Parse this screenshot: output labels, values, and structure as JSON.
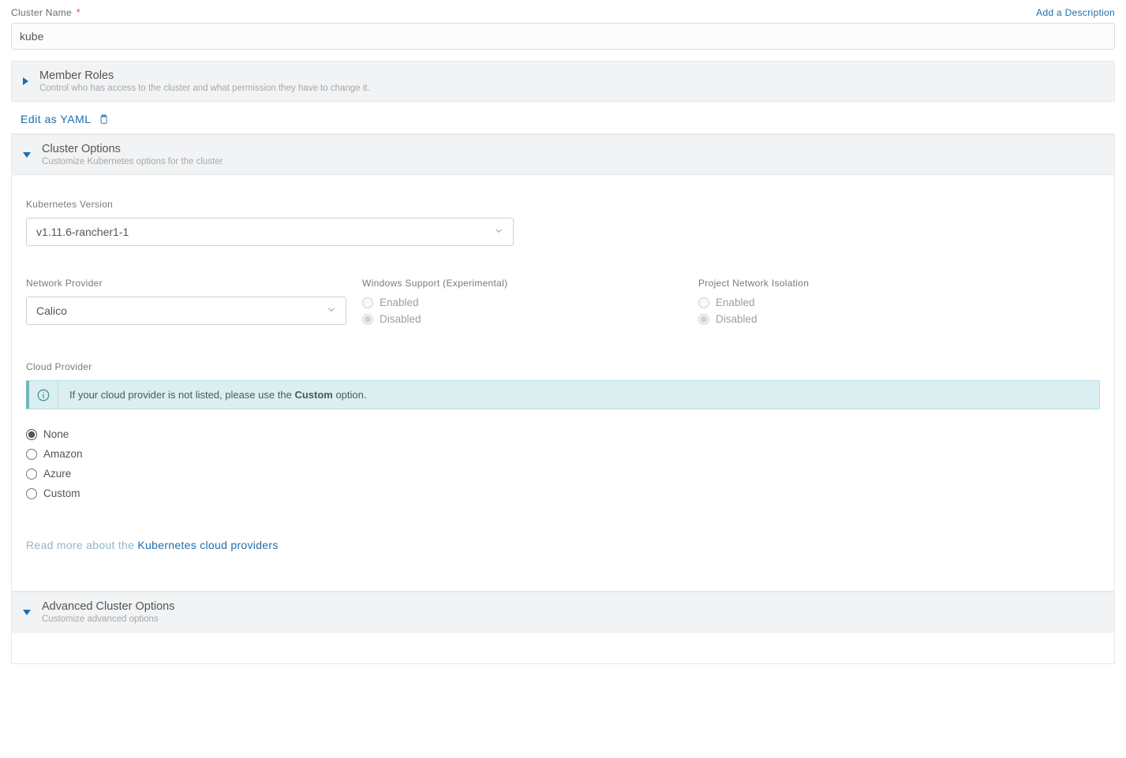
{
  "clusterName": {
    "label": "Cluster Name",
    "required": "*",
    "value": "kube"
  },
  "addDescription": "Add a Description",
  "memberRoles": {
    "title": "Member Roles",
    "sub": "Control who has access to the cluster and what permission they have to change it."
  },
  "editYaml": "Edit as YAML",
  "clusterOptions": {
    "title": "Cluster Options",
    "sub": "Customize Kubernetes options for the cluster"
  },
  "k8sVersion": {
    "label": "Kubernetes Version",
    "value": "v1.11.6-rancher1-1"
  },
  "networkProvider": {
    "label": "Network Provider",
    "value": "Calico"
  },
  "windowsSupport": {
    "label": "Windows Support (Experimental)",
    "enabled": "Enabled",
    "disabled": "Disabled"
  },
  "projIsolation": {
    "label": "Project Network Isolation",
    "enabled": "Enabled",
    "disabled": "Disabled"
  },
  "cloudProvider": {
    "label": "Cloud Provider",
    "bannerPrefix": "If your cloud provider is not listed, please use the ",
    "bannerBold": "Custom",
    "bannerSuffix": " option.",
    "options": {
      "none": "None",
      "amazon": "Amazon",
      "azure": "Azure",
      "custom": "Custom"
    }
  },
  "readMore": {
    "prefix": "Read more about the ",
    "link": "Kubernetes cloud providers"
  },
  "advanced": {
    "title": "Advanced Cluster Options",
    "sub": "Customize advanced options"
  }
}
